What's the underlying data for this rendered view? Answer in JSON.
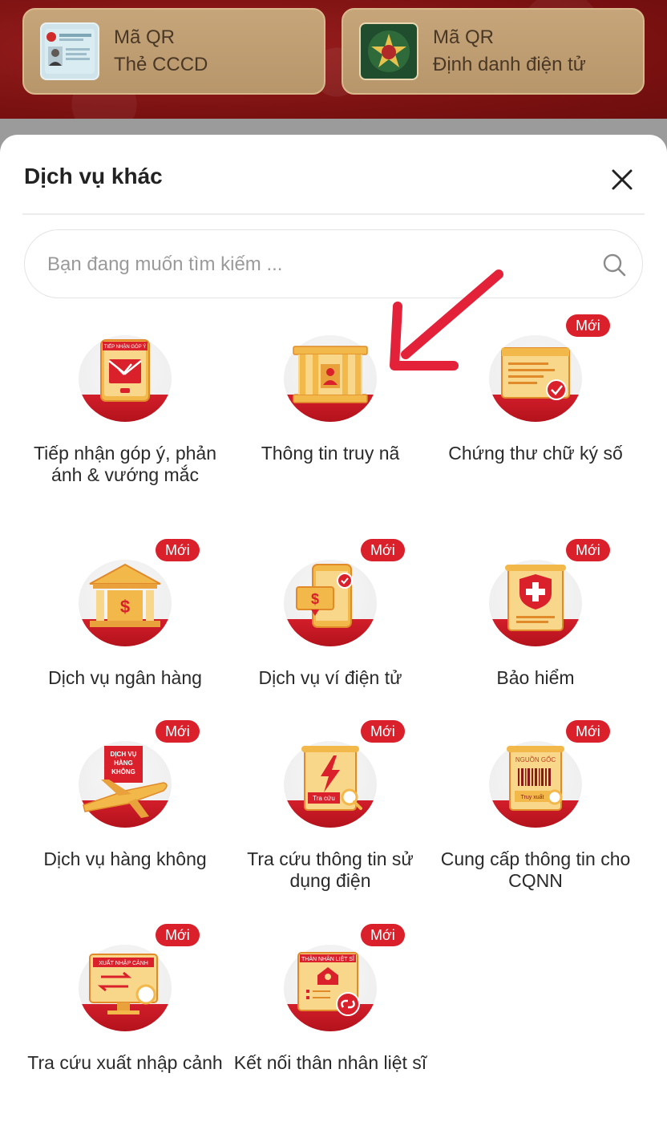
{
  "qr_cards": [
    {
      "line1": "Mã QR",
      "line2": "Thẻ CCCD"
    },
    {
      "line1": "Mã QR",
      "line2": "Định danh điện tử"
    }
  ],
  "sheet": {
    "title": "Dịch vụ khác",
    "search_placeholder": "Bạn đang muốn tìm kiếm ..."
  },
  "badge_text": "Mới",
  "services": [
    {
      "label": "Tiếp nhận góp ý, phản ánh & vướng mắc",
      "icon": "feedback-envelope-icon",
      "is_new": false
    },
    {
      "label": "Thông tin truy nã",
      "icon": "wanted-jail-icon",
      "is_new": false
    },
    {
      "label": "Chứng thư chữ ký số",
      "icon": "digital-certificate-icon",
      "is_new": true
    },
    {
      "label": "Dịch vụ ngân hàng",
      "icon": "bank-icon",
      "is_new": true
    },
    {
      "label": "Dịch vụ ví điện tử",
      "icon": "e-wallet-icon",
      "is_new": true
    },
    {
      "label": "Bảo hiểm",
      "icon": "insurance-shield-icon",
      "is_new": true
    },
    {
      "label": "Dịch vụ hàng không",
      "icon": "airplane-icon",
      "is_new": true
    },
    {
      "label": "Tra cứu thông tin sử dụng điện",
      "icon": "electricity-bolt-icon",
      "is_new": true
    },
    {
      "label": "Cung cấp thông tin cho CQNN",
      "icon": "barcode-origin-icon",
      "is_new": true
    },
    {
      "label": "Tra cứu xuất nhập cảnh",
      "icon": "immigration-monitor-icon",
      "is_new": true
    },
    {
      "label": "Kết nối thân nhân liệt sĩ",
      "icon": "martyr-family-link-icon",
      "is_new": true
    }
  ],
  "icon_art_text": {
    "feedback": "TIẾP NHẬN GÓP Ý",
    "airplane": [
      "DỊCH VỤ",
      "HÀNG",
      "KHÔNG"
    ],
    "electricity": "Tra cứu",
    "origin_top": "NGUỒN GỐC",
    "origin_bottom": "Truy xuất",
    "immigration": "XUẤT NHẬP CẢNH",
    "martyr": "THÂN NHÂN LIỆT SĨ"
  },
  "colors": {
    "accent_red": "#d9202b",
    "gold": "#f2b84a",
    "header_red": "#7d1212"
  }
}
